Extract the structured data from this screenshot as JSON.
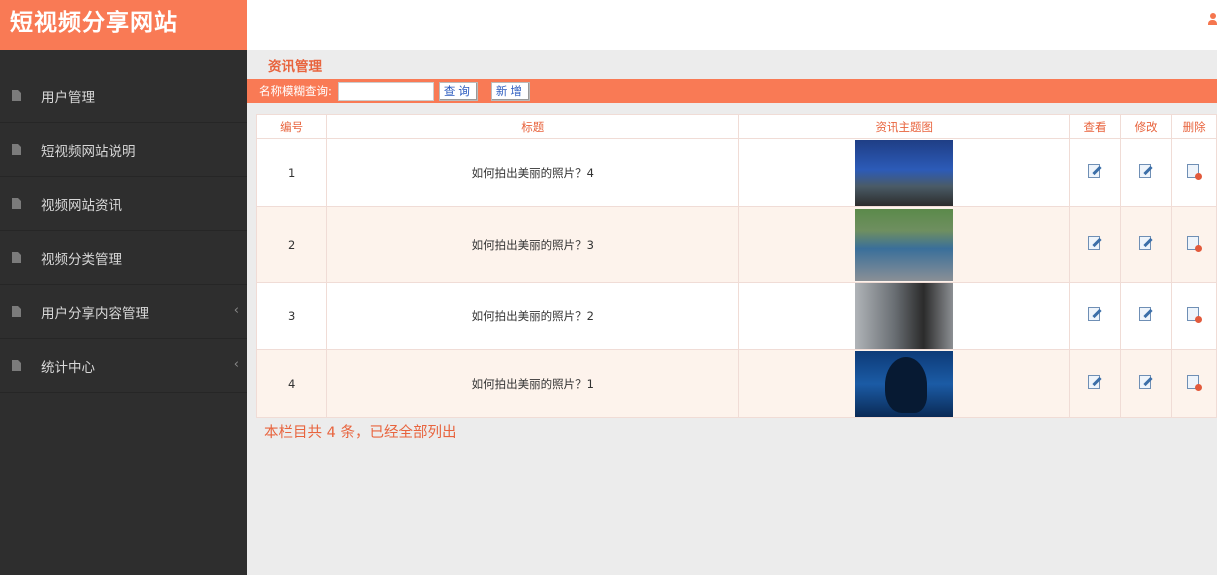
{
  "app": {
    "title": "短视频分享网站"
  },
  "sidebar": {
    "items": [
      {
        "label": "用户管理",
        "has_submenu": false
      },
      {
        "label": "短视频网站说明",
        "has_submenu": false
      },
      {
        "label": "视频网站资讯",
        "has_submenu": false
      },
      {
        "label": "视频分类管理",
        "has_submenu": false
      },
      {
        "label": "用户分享内容管理",
        "has_submenu": true,
        "chevron": "‹"
      },
      {
        "label": "统计中心",
        "has_submenu": true,
        "chevron": "‹"
      }
    ]
  },
  "main": {
    "section_title": "资讯管理",
    "search": {
      "label": "名称模糊查询:",
      "value": "",
      "query_button": "查询",
      "add_button": "新增"
    },
    "table": {
      "columns": [
        "编号",
        "标题",
        "资讯主题图",
        "查看",
        "修改",
        "删除"
      ],
      "rows": [
        {
          "id": "1",
          "title": "如何拍出美丽的照片？4"
        },
        {
          "id": "2",
          "title": "如何拍出美丽的照片？3"
        },
        {
          "id": "3",
          "title": "如何拍出美丽的照片？2"
        },
        {
          "id": "4",
          "title": "如何拍出美丽的照片？1"
        }
      ]
    },
    "summary": "本栏目共 4 条，已经全部列出"
  },
  "colors": {
    "accent": "#f97a55",
    "sidebar_bg": "#2e2e2e",
    "row_alt": "#fdf3ec",
    "header_text": "#e8643e"
  },
  "icons": {
    "sidebar_item": "document-icon",
    "user": "user-icon",
    "view": "edit-page-icon",
    "edit": "edit-page-icon",
    "delete": "delete-page-icon"
  }
}
